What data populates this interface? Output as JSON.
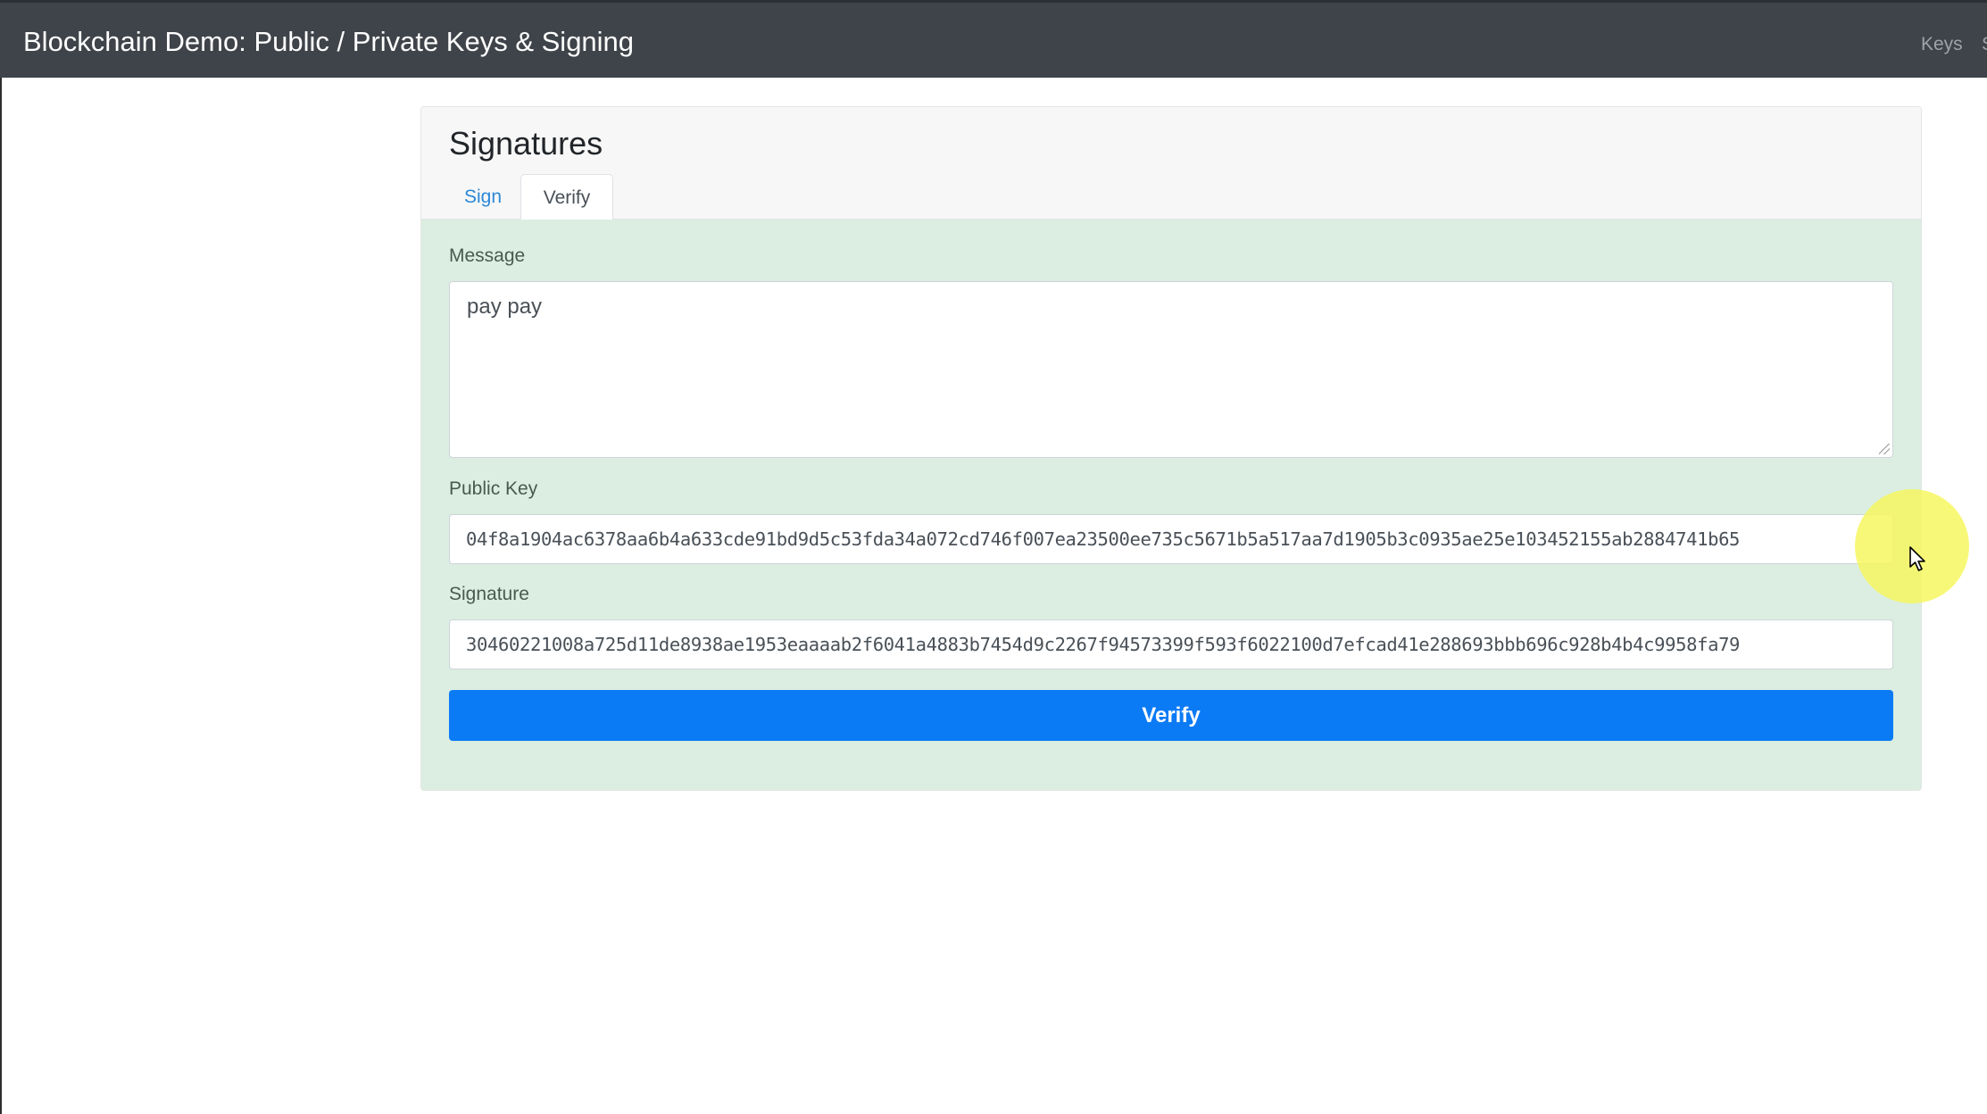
{
  "navbar": {
    "title": "Blockchain Demo: Public / Private Keys & Signing",
    "links": [
      "Keys",
      "S"
    ]
  },
  "card": {
    "title": "Signatures",
    "tabs": [
      {
        "label": "Sign",
        "active": false
      },
      {
        "label": "Verify",
        "active": true
      }
    ]
  },
  "form": {
    "message_label": "Message",
    "message_value": "pay pay",
    "public_key_label": "Public Key",
    "public_key_value": "04f8a1904ac6378aa6b4a633cde91bd9d5c53fda34a072cd746f007ea23500ee735c5671b5a517aa7d1905b3c0935ae25e103452155ab2884741b65",
    "signature_label": "Signature",
    "signature_value": "30460221008a725d11de8938ae1953eaaaab2f6041a4883b7454d9c2267f94573399f593f6022100d7efcad41e288693bbb696c928b4b4c9958fa79",
    "verify_button": "Verify"
  },
  "colors": {
    "navbar_bg": "#3f444a",
    "card_body_bg": "#dbeee1",
    "primary": "#0b7bf5",
    "tab_link": "#2b88d8",
    "cursor_highlight": "#f6f65a"
  }
}
